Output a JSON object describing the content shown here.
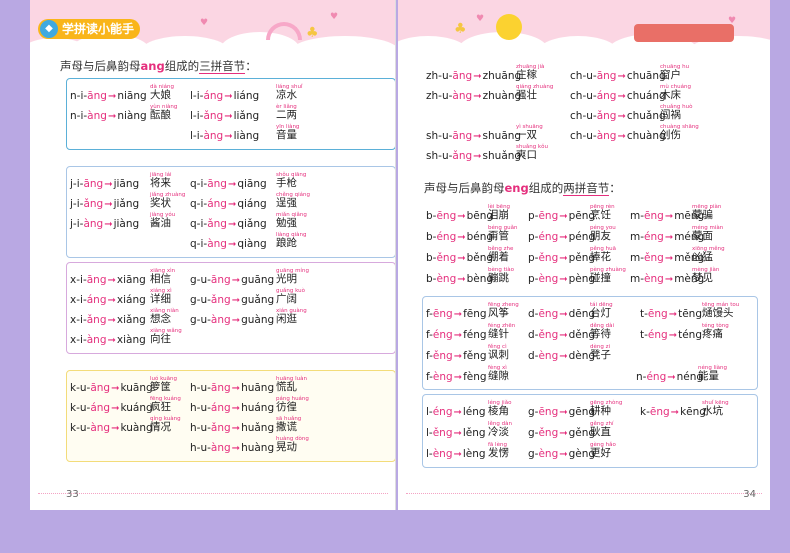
{
  "header": {
    "brand": "学拼读小能手",
    "brand_icon": "fish-icon"
  },
  "left": {
    "page_number": "33",
    "heading": {
      "pre": "声母与后鼻韵母",
      "kw": "ang",
      "mid": "组成的",
      "ul": "三拼音节",
      "post": "："
    },
    "boxes": [
      {
        "color": "#5bb0d8",
        "rows": [
          [
            {
              "parts": [
                "n",
                "i",
                "āng"
              ],
              "res": "niāng",
              "word": "大娘",
              "py": "dà niáng"
            },
            {
              "parts": [
                "l",
                "i",
                "áng"
              ],
              "res": "liáng",
              "word": "凉水",
              "py": "liáng shuǐ"
            }
          ],
          [
            {
              "parts": [
                "n",
                "i",
                "àng"
              ],
              "res": "niàng",
              "word": "酝酿",
              "py": "yùn niàng"
            },
            {
              "parts": [
                "l",
                "i",
                "ǎng"
              ],
              "res": "liǎng",
              "word": "二两",
              "py": "èr liǎng"
            }
          ],
          [
            null,
            {
              "parts": [
                "l",
                "i",
                "àng"
              ],
              "res": "liàng",
              "word": "音量",
              "py": "yīn liàng"
            }
          ]
        ]
      },
      {
        "color": "#a9c6e6",
        "rows": [
          [
            {
              "parts": [
                "j",
                "i",
                "āng"
              ],
              "res": "jiāng",
              "word": "将来",
              "py": "jiāng lái"
            },
            {
              "parts": [
                "q",
                "i",
                "āng"
              ],
              "res": "qiāng",
              "word": "手枪",
              "py": "shǒu qiāng"
            }
          ],
          [
            {
              "parts": [
                "j",
                "i",
                "ǎng"
              ],
              "res": "jiǎng",
              "word": "奖状",
              "py": "jiǎng zhuàng"
            },
            {
              "parts": [
                "q",
                "i",
                "áng"
              ],
              "res": "qiáng",
              "word": "逞强",
              "py": "chěng qiáng"
            }
          ],
          [
            {
              "parts": [
                "j",
                "i",
                "àng"
              ],
              "res": "jiàng",
              "word": "酱油",
              "py": "jiàng yóu"
            },
            {
              "parts": [
                "q",
                "i",
                "ǎng"
              ],
              "res": "qiǎng",
              "word": "勉强",
              "py": "miǎn qiǎng"
            }
          ],
          [
            null,
            {
              "parts": [
                "q",
                "i",
                "àng"
              ],
              "res": "qiàng",
              "word": "踉跄",
              "py": "liàng qiàng"
            }
          ]
        ]
      },
      {
        "color": "#d7a9dd",
        "rows": [
          [
            {
              "parts": [
                "x",
                "i",
                "āng"
              ],
              "res": "xiāng",
              "word": "相信",
              "py": "xiāng xìn"
            },
            {
              "parts": [
                "g",
                "u",
                "āng"
              ],
              "res": "guāng",
              "word": "光明",
              "py": "guāng míng"
            }
          ],
          [
            {
              "parts": [
                "x",
                "i",
                "áng"
              ],
              "res": "xiáng",
              "word": "详细",
              "py": "xiáng xì"
            },
            {
              "parts": [
                "g",
                "u",
                "ǎng"
              ],
              "res": "guǎng",
              "word": "广阔",
              "py": "guǎng kuò"
            }
          ],
          [
            {
              "parts": [
                "x",
                "i",
                "ǎng"
              ],
              "res": "xiǎng",
              "word": "想念",
              "py": "xiǎng niàn"
            },
            {
              "parts": [
                "g",
                "u",
                "àng"
              ],
              "res": "guàng",
              "word": "闲逛",
              "py": "xián guàng"
            }
          ],
          [
            {
              "parts": [
                "x",
                "i",
                "àng"
              ],
              "res": "xiàng",
              "word": "向往",
              "py": "xiàng wǎng"
            },
            null
          ]
        ]
      },
      {
        "color": "#f3dc7a",
        "rows": [
          [
            {
              "parts": [
                "k",
                "u",
                "āng"
              ],
              "res": "kuāng",
              "word": "箩筐",
              "py": "luó kuāng"
            },
            {
              "parts": [
                "h",
                "u",
                "āng"
              ],
              "res": "huāng",
              "word": "慌乱",
              "py": "huāng luàn"
            }
          ],
          [
            {
              "parts": [
                "k",
                "u",
                "áng"
              ],
              "res": "kuáng",
              "word": "疯狂",
              "py": "fēng kuáng"
            },
            {
              "parts": [
                "h",
                "u",
                "áng"
              ],
              "res": "huáng",
              "word": "彷徨",
              "py": "páng huáng"
            }
          ],
          [
            {
              "parts": [
                "k",
                "u",
                "àng"
              ],
              "res": "kuàng",
              "word": "情况",
              "py": "qíng kuàng"
            },
            {
              "parts": [
                "h",
                "u",
                "ǎng"
              ],
              "res": "huǎng",
              "word": "撒谎",
              "py": "sā huǎng"
            }
          ],
          [
            null,
            {
              "parts": [
                "h",
                "u",
                "àng"
              ],
              "res": "huàng",
              "word": "晃动",
              "py": "huàng dòng"
            }
          ]
        ]
      }
    ]
  },
  "right": {
    "page_number": "34",
    "top_rows": [
      [
        {
          "parts": [
            "zh",
            "u",
            "āng"
          ],
          "res": "zhuāng",
          "word": "庄稼",
          "py": "zhuāng jià"
        },
        {
          "parts": [
            "ch",
            "u",
            "āng"
          ],
          "res": "chuāng",
          "word": "窗户",
          "py": "chuāng hu"
        }
      ],
      [
        {
          "parts": [
            "zh",
            "u",
            "àng"
          ],
          "res": "zhuàng",
          "word": "强壮",
          "py": "qiáng zhuàng"
        },
        {
          "parts": [
            "ch",
            "u",
            "áng"
          ],
          "res": "chuáng",
          "word": "木床",
          "py": "mù chuáng"
        }
      ],
      [
        null,
        {
          "parts": [
            "ch",
            "u",
            "ǎng"
          ],
          "res": "chuǎng",
          "word": "闯祸",
          "py": "chuǎng huò"
        }
      ],
      [
        {
          "parts": [
            "sh",
            "u",
            "āng"
          ],
          "res": "shuāng",
          "word": "一双",
          "py": "yì shuāng"
        },
        {
          "parts": [
            "ch",
            "u",
            "àng"
          ],
          "res": "chuàng",
          "word": "创伤",
          "py": "chuàng shāng"
        }
      ],
      [
        {
          "parts": [
            "sh",
            "u",
            "ǎng"
          ],
          "res": "shuǎng",
          "word": "爽口",
          "py": "shuǎng kǒu"
        },
        null
      ]
    ],
    "heading": {
      "pre": "声母与后鼻韵母",
      "kw": "eng",
      "mid": "组成的",
      "ul": "两拼音节",
      "post": "："
    },
    "eng_rows": [
      [
        {
          "parts": [
            "b",
            "ēng"
          ],
          "res": "bēng",
          "word": "泪崩",
          "py": "lèi bēng"
        },
        {
          "parts": [
            "p",
            "ēng"
          ],
          "res": "pēng",
          "word": "烹饪",
          "py": "pēng rèn"
        },
        {
          "parts": [
            "m",
            "ēng"
          ],
          "res": "mēng",
          "word": "蒙骗",
          "py": "mēng piàn"
        }
      ],
      [
        {
          "parts": [
            "b",
            "éng"
          ],
          "res": "béng",
          "word": "甭管",
          "py": "béng guǎn"
        },
        {
          "parts": [
            "p",
            "éng"
          ],
          "res": "péng",
          "word": "朋友",
          "py": "péng you"
        },
        {
          "parts": [
            "m",
            "éng"
          ],
          "res": "méng",
          "word": "蒙面",
          "py": "méng miàn"
        }
      ],
      [
        {
          "parts": [
            "b",
            "ěng"
          ],
          "res": "běng",
          "word": "绷着",
          "py": "běng zhe"
        },
        {
          "parts": [
            "p",
            "ěng"
          ],
          "res": "pěng",
          "word": "捧花",
          "py": "pěng huā"
        },
        {
          "parts": [
            "m",
            "ěng"
          ],
          "res": "měng",
          "word": "凶猛",
          "py": "xiōng měng"
        }
      ],
      [
        {
          "parts": [
            "b",
            "èng"
          ],
          "res": "bèng",
          "word": "蹦跳",
          "py": "bèng tiào"
        },
        {
          "parts": [
            "p",
            "èng"
          ],
          "res": "pèng",
          "word": "碰撞",
          "py": "pèng zhuàng"
        },
        {
          "parts": [
            "m",
            "èng"
          ],
          "res": "mèng",
          "word": "梦见",
          "py": "mèng jiàn"
        }
      ]
    ],
    "boxes": [
      {
        "color": "#a9c6e6",
        "rows": [
          [
            {
              "parts": [
                "f",
                "ēng"
              ],
              "res": "fēng",
              "word": "风筝",
              "py": "fēng zheng"
            },
            {
              "parts": [
                "d",
                "ēng"
              ],
              "res": "dēng",
              "word": "台灯",
              "py": "tái dēng"
            },
            {
              "parts": [
                "t",
                "ēng"
              ],
              "res": "tēng",
              "word": "熥馒头",
              "py": "tēng mán tou"
            }
          ],
          [
            {
              "parts": [
                "f",
                "éng"
              ],
              "res": "féng",
              "word": "缝针",
              "py": "féng zhēn"
            },
            {
              "parts": [
                "d",
                "ěng"
              ],
              "res": "děng",
              "word": "等待",
              "py": "děng dài"
            },
            {
              "parts": [
                "t",
                "éng"
              ],
              "res": "téng",
              "word": "疼痛",
              "py": "téng tòng"
            }
          ],
          [
            {
              "parts": [
                "f",
                "ěng"
              ],
              "res": "fěng",
              "word": "讽刺",
              "py": "fěng cì"
            },
            {
              "parts": [
                "d",
                "èng"
              ],
              "res": "dèng",
              "word": "凳子",
              "py": "dèng zi"
            },
            null
          ],
          [
            {
              "parts": [
                "f",
                "èng"
              ],
              "res": "fèng",
              "word": "缝隙",
              "py": "fèng xì"
            },
            null,
            {
              "parts": [
                "n",
                "éng"
              ],
              "res": "néng",
              "word": "能量",
              "py": "néng liàng"
            }
          ]
        ]
      },
      {
        "color": "#a9c6e6",
        "rows": [
          [
            {
              "parts": [
                "l",
                "éng"
              ],
              "res": "léng",
              "word": "棱角",
              "py": "léng jiǎo"
            },
            {
              "parts": [
                "g",
                "ēng"
              ],
              "res": "gēng",
              "word": "耕种",
              "py": "gēng zhòng"
            },
            {
              "parts": [
                "k",
                "ēng"
              ],
              "res": "kēng",
              "word": "水坑",
              "py": "shuǐ kēng"
            }
          ],
          [
            {
              "parts": [
                "l",
                "ěng"
              ],
              "res": "lěng",
              "word": "冷淡",
              "py": "lěng dàn"
            },
            {
              "parts": [
                "g",
                "ěng"
              ],
              "res": "gěng",
              "word": "耿直",
              "py": "gěng zhí"
            },
            null
          ],
          [
            {
              "parts": [
                "l",
                "èng"
              ],
              "res": "lèng",
              "word": "发愣",
              "py": "fā lèng"
            },
            {
              "parts": [
                "g",
                "èng"
              ],
              "res": "gèng",
              "word": "更好",
              "py": "gèng hǎo"
            },
            null
          ]
        ]
      }
    ]
  }
}
